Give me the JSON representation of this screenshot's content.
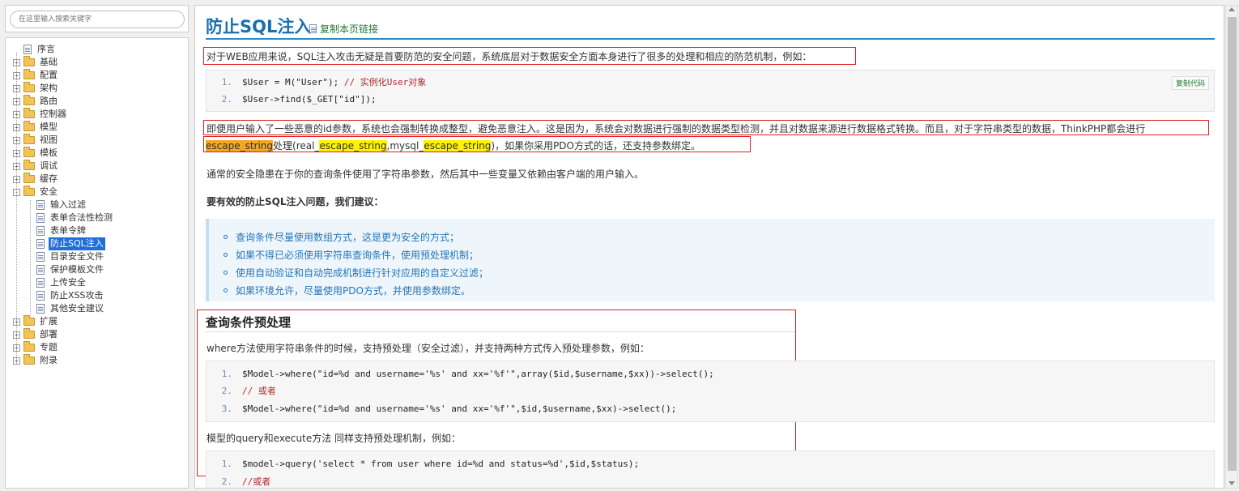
{
  "search": {
    "placeholder": "在这里输入搜索关键字"
  },
  "tree": [
    {
      "label": "序言",
      "type": "doc",
      "level": 0
    },
    {
      "label": "基础",
      "type": "folder",
      "level": 0,
      "expander": "+"
    },
    {
      "label": "配置",
      "type": "folder",
      "level": 0,
      "expander": "+"
    },
    {
      "label": "架构",
      "type": "folder",
      "level": 0,
      "expander": "+"
    },
    {
      "label": "路由",
      "type": "folder",
      "level": 0,
      "expander": "+"
    },
    {
      "label": "控制器",
      "type": "folder",
      "level": 0,
      "expander": "+"
    },
    {
      "label": "模型",
      "type": "folder",
      "level": 0,
      "expander": "+"
    },
    {
      "label": "视图",
      "type": "folder",
      "level": 0,
      "expander": "+"
    },
    {
      "label": "模板",
      "type": "folder",
      "level": 0,
      "expander": "+"
    },
    {
      "label": "调试",
      "type": "folder",
      "level": 0,
      "expander": "+"
    },
    {
      "label": "缓存",
      "type": "folder",
      "level": 0,
      "expander": "+"
    },
    {
      "label": "安全",
      "type": "folder",
      "level": 0,
      "expander": "-"
    },
    {
      "label": "输入过滤",
      "type": "doc",
      "level": 1
    },
    {
      "label": "表单合法性检测",
      "type": "doc",
      "level": 1
    },
    {
      "label": "表单令牌",
      "type": "doc",
      "level": 1
    },
    {
      "label": "防止SQL注入",
      "type": "doc",
      "level": 1,
      "selected": true
    },
    {
      "label": "目录安全文件",
      "type": "doc",
      "level": 1
    },
    {
      "label": "保护模板文件",
      "type": "doc",
      "level": 1
    },
    {
      "label": "上传安全",
      "type": "doc",
      "level": 1
    },
    {
      "label": "防止XSS攻击",
      "type": "doc",
      "level": 1
    },
    {
      "label": "其他安全建议",
      "type": "doc",
      "level": 1
    },
    {
      "label": "扩展",
      "type": "folder",
      "level": 0,
      "expander": "+"
    },
    {
      "label": "部署",
      "type": "folder",
      "level": 0,
      "expander": "+"
    },
    {
      "label": "专题",
      "type": "folder",
      "level": 0,
      "expander": "+"
    },
    {
      "label": "附录",
      "type": "folder",
      "level": 0,
      "expander": "+"
    }
  ],
  "content": {
    "title": "防止SQL注入",
    "copy_link": "复制本页链接",
    "intro": "对于WEB应用来说，SQL注入攻击无疑是首要防范的安全问题，系统底层对于数据安全方面本身进行了很多的处理和相应的防范机制，例如：",
    "copy_code_label": "复制代码",
    "code1": [
      {
        "num": "1.",
        "code": "$User = M(\"User\"); ",
        "comment": "// 实例化User对象"
      },
      {
        "num": "2.",
        "code": "$User->find($_GET[\"id\"]);",
        "comment": ""
      }
    ],
    "p2_line1": "即便用户输入了一些恶意的id参数，系统也会强制转换成整型，避免恶意注入。这是因为，系统会对数据进行强制的数据类型检测，并且对数据来源进行数据格式转换。而且，对于字符串类型的数据，ThinkPHP都会进行",
    "p2_hl1": "escape_string",
    "p2_t1": "处理(real_",
    "p2_hl2": "escape_string",
    "p2_t2": ",mysql_",
    "p2_hl3": "escape_string",
    "p2_t3": ")，如果你采用PDO方式的话，还支持参数绑定。",
    "p3": "通常的安全隐患在于你的查询条件使用了字符串参数，然后其中一些变量又依赖由客户端的用户输入。",
    "p4": "要有效的防止SQL注入问题，我们建议：",
    "suggestions": [
      "查询条件尽量使用数组方式，这是更为安全的方式；",
      "如果不得已必须使用字符串查询条件，使用预处理机制；",
      "使用自动验证和自动完成机制进行针对应用的自定义过滤；",
      "如果环境允许，尽量使用PDO方式，并使用参数绑定。"
    ],
    "section_title": "查询条件预处理",
    "p5": "where方法使用字符串条件的时候，支持预处理（安全过滤），并支持两种方式传入预处理参数，例如：",
    "code2": [
      {
        "num": "1.",
        "code": "$Model->where(\"id=%d and username='%s' and xx='%f'\",array($id,$username,$xx))->select();",
        "comment": ""
      },
      {
        "num": "2.",
        "code": "",
        "comment": "// 或者"
      },
      {
        "num": "3.",
        "code": "$Model->where(\"id=%d and username='%s' and xx='%f'\",$id,$username,$xx)->select();",
        "comment": ""
      }
    ],
    "p6": "模型的query和execute方法 同样支持预处理机制，例如：",
    "code3": [
      {
        "num": "1.",
        "code": "$model->query('select * from user where id=%d and status=%d',$id,$status);",
        "comment": ""
      },
      {
        "num": "2.",
        "code": "",
        "comment": "//或者"
      }
    ]
  },
  "colors": {
    "title": "#1a6fb0",
    "link": "#1f7a34",
    "selected": "#1e6fd9",
    "highlight_orange": "#f5a623",
    "highlight_yellow": "#fff200",
    "annotation": "#e02020"
  }
}
